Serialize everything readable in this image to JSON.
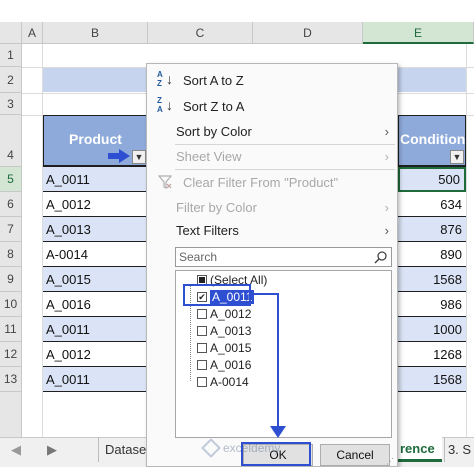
{
  "columns": [
    "A",
    "B",
    "C",
    "D",
    "E"
  ],
  "rows": [
    "1",
    "2",
    "3",
    "4",
    "5",
    "6",
    "7",
    "8",
    "9",
    "10",
    "11",
    "12",
    "13"
  ],
  "table": {
    "header_left": "Product",
    "header_right": "Condition",
    "products": [
      "A_0011",
      "A_0012",
      "A_0013",
      "A-0014",
      "A_0015",
      "A_0016",
      "A_0011",
      "A_0012",
      "A_0011"
    ],
    "conditions": [
      "500",
      "634",
      "876",
      "890",
      "1568",
      "986",
      "1000",
      "1268",
      "1568"
    ]
  },
  "menu": {
    "sort_az": "Sort A to Z",
    "sort_za": "Sort Z to A",
    "sort_by_color": "Sort by Color",
    "sheet_view": "Sheet View",
    "clear_filter": "Clear Filter From \"Product\"",
    "filter_by_color": "Filter by Color",
    "text_filters": "Text Filters",
    "search_placeholder": "Search",
    "items": [
      "(Select All)",
      "A_0011",
      "A_0012",
      "A_0013",
      "A_0015",
      "A_0016",
      "A-0014"
    ],
    "ok": "OK",
    "cancel": "Cancel"
  },
  "tabs": {
    "dataset": "Dataset",
    "reference": "rence",
    "third": "3. S"
  },
  "watermark": "exceldemy",
  "colors": {
    "accent_blue": "#2e4fd1",
    "excel_green": "#1e6b3c",
    "table_fill": "#dbe4f6",
    "header_fill": "#8eaadb"
  }
}
